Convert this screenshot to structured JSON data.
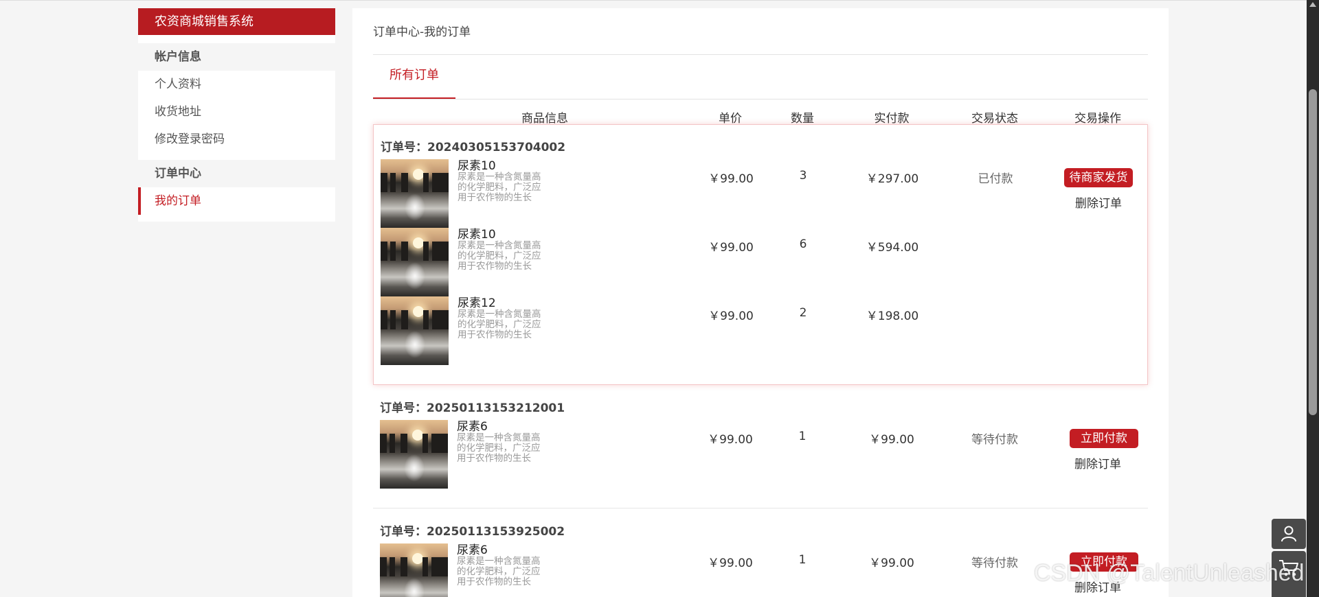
{
  "sidebar": {
    "brand": "农资商城销售系统",
    "groups": [
      {
        "title": "帐户信息",
        "items": [
          "个人资料",
          "收货地址",
          "修改登录密码"
        ]
      },
      {
        "title": "订单中心",
        "items": [
          "我的订单"
        ]
      }
    ]
  },
  "main": {
    "breadcrumb": "订单中心-我的订单",
    "tab": "所有订单",
    "headers": [
      "商品信息",
      "单价",
      "数量",
      "实付款",
      "交易状态",
      "交易操作"
    ]
  },
  "orders": [
    {
      "label": "订单号：",
      "number": "20240305153704002",
      "status": "已付款",
      "action": "待商家发货",
      "delete": "删除订单",
      "items": [
        {
          "name": "尿素10",
          "desc": "尿素是一种含氮量高的化学肥料，广泛应用于农作物的生长",
          "price": "￥99.00",
          "qty": "3",
          "paid": "￥297.00"
        },
        {
          "name": "尿素10",
          "desc": "尿素是一种含氮量高的化学肥料，广泛应用于农作物的生长",
          "price": "￥99.00",
          "qty": "6",
          "paid": "￥594.00"
        },
        {
          "name": "尿素12",
          "desc": "尿素是一种含氮量高的化学肥料，广泛应用于农作物的生长",
          "price": "￥99.00",
          "qty": "2",
          "paid": "￥198.00"
        }
      ]
    },
    {
      "label": "订单号：",
      "number": "20250113153212001",
      "status": "等待付款",
      "action": "立即付款",
      "delete": "删除订单",
      "items": [
        {
          "name": "尿素6",
          "desc": "尿素是一种含氮量高的化学肥料，广泛应用于农作物的生长",
          "price": "￥99.00",
          "qty": "1",
          "paid": "￥99.00"
        }
      ]
    },
    {
      "label": "订单号：",
      "number": "20250113153925002",
      "status": "等待付款",
      "action": "立即付款",
      "delete": "删除订单",
      "items": [
        {
          "name": "尿素6",
          "desc": "尿素是一种含氮量高的化学肥料，广泛应用于农作物的生长",
          "price": "￥99.00",
          "qty": "1",
          "paid": "￥99.00"
        }
      ]
    }
  ],
  "watermark": "CSDN @TalentUnleashed",
  "colors": {
    "accent": "#c31d23",
    "brand_bg": "#b71c21"
  },
  "floating_icons": [
    "user-icon",
    "cart-icon"
  ]
}
